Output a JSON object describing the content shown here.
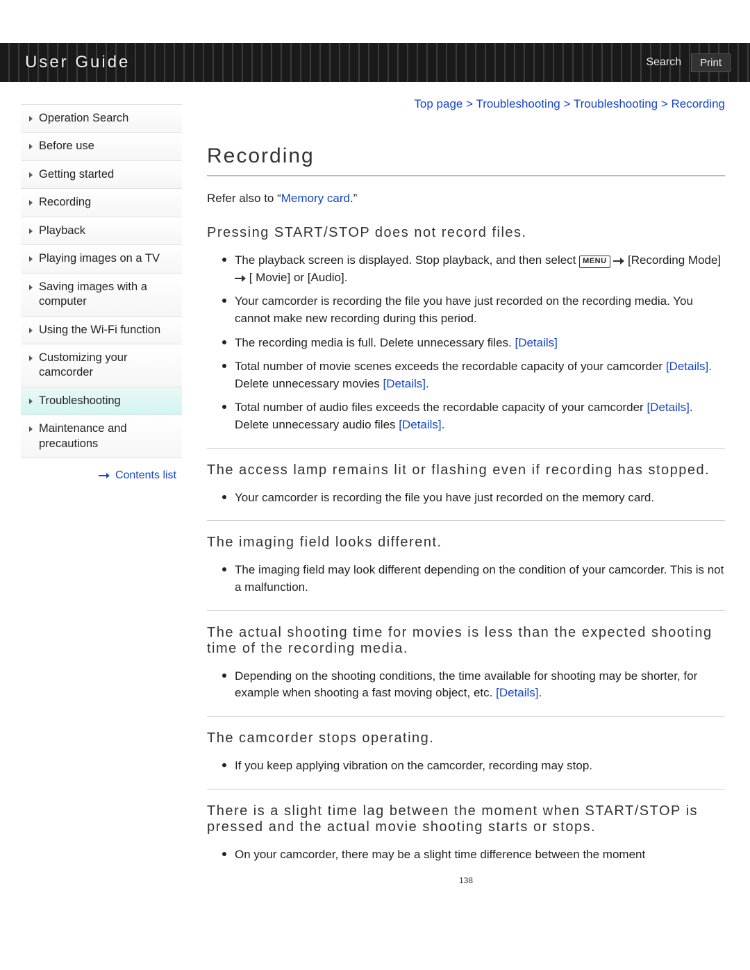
{
  "header": {
    "title": "User Guide",
    "search_label": "Search",
    "print_label": "Print"
  },
  "breadcrumb": {
    "items": [
      "Top page",
      "Troubleshooting",
      "Troubleshooting",
      "Recording"
    ],
    "sep": ">"
  },
  "sidebar": {
    "items": [
      {
        "label": "Operation Search"
      },
      {
        "label": "Before use"
      },
      {
        "label": "Getting started"
      },
      {
        "label": "Recording"
      },
      {
        "label": "Playback"
      },
      {
        "label": "Playing images on a TV"
      },
      {
        "label": "Saving images with a computer"
      },
      {
        "label": "Using the Wi-Fi function"
      },
      {
        "label": "Customizing your camcorder"
      },
      {
        "label": "Troubleshooting",
        "active": true
      },
      {
        "label": "Maintenance and precautions"
      }
    ],
    "contents_list_label": "Contents list"
  },
  "page": {
    "title": "Recording",
    "intro_prefix": "Refer also to “",
    "intro_link": "Memory card",
    "intro_suffix": ".”",
    "page_number": "138",
    "menu_box_label": "MENU",
    "sections": [
      {
        "heading": "Pressing START/STOP does not record files.",
        "items": [
          {
            "parts": [
              {
                "t": "text",
                "v": "The playback screen is displayed. Stop playback, and then select "
              },
              {
                "t": "menu"
              },
              {
                "t": "text",
                "v": " "
              },
              {
                "t": "arrow"
              },
              {
                "t": "text",
                "v": " [Recording Mode] "
              },
              {
                "t": "arrow"
              },
              {
                "t": "text",
                "v": " [ Movie] or [Audio]."
              }
            ]
          },
          {
            "parts": [
              {
                "t": "text",
                "v": "Your camcorder is recording the file you have just recorded on the recording media. You cannot make new recording during this period."
              }
            ]
          },
          {
            "parts": [
              {
                "t": "text",
                "v": "The recording media is full. Delete unnecessary files. "
              },
              {
                "t": "link",
                "v": "[Details]"
              }
            ]
          },
          {
            "parts": [
              {
                "t": "text",
                "v": "Total number of movie scenes exceeds the recordable capacity of your camcorder "
              },
              {
                "t": "link",
                "v": "[Details]"
              },
              {
                "t": "text",
                "v": ". Delete unnecessary movies "
              },
              {
                "t": "link",
                "v": "[Details]"
              },
              {
                "t": "text",
                "v": "."
              }
            ]
          },
          {
            "parts": [
              {
                "t": "text",
                "v": "Total number of audio files exceeds the recordable capacity of your camcorder "
              },
              {
                "t": "link",
                "v": "[Details]"
              },
              {
                "t": "text",
                "v": ". Delete unnecessary audio files "
              },
              {
                "t": "link",
                "v": "[Details]"
              },
              {
                "t": "text",
                "v": "."
              }
            ]
          }
        ]
      },
      {
        "heading": "The access lamp remains lit or flashing even if recording has stopped.",
        "items": [
          {
            "parts": [
              {
                "t": "text",
                "v": "Your camcorder is recording the file you have just recorded on the memory card."
              }
            ]
          }
        ]
      },
      {
        "heading": "The imaging field looks different.",
        "items": [
          {
            "parts": [
              {
                "t": "text",
                "v": "The imaging field may look different depending on the condition of your camcorder. This is not a malfunction."
              }
            ]
          }
        ]
      },
      {
        "heading": "The actual shooting time for movies is less than the expected shooting time of the recording media.",
        "items": [
          {
            "parts": [
              {
                "t": "text",
                "v": "Depending on the shooting conditions, the time available for shooting may be shorter, for example when shooting a fast moving object, etc. "
              },
              {
                "t": "link",
                "v": "[Details]"
              },
              {
                "t": "text",
                "v": "."
              }
            ]
          }
        ]
      },
      {
        "heading": "The camcorder stops operating.",
        "items": [
          {
            "parts": [
              {
                "t": "text",
                "v": "If you keep applying vibration on the camcorder, recording may stop."
              }
            ]
          }
        ]
      },
      {
        "heading": "There is a slight time lag between the moment when START/STOP is pressed and the actual movie shooting starts or stops.",
        "items": [
          {
            "parts": [
              {
                "t": "text",
                "v": "On your camcorder, there may be a slight time difference between the moment"
              }
            ]
          }
        ]
      }
    ]
  }
}
